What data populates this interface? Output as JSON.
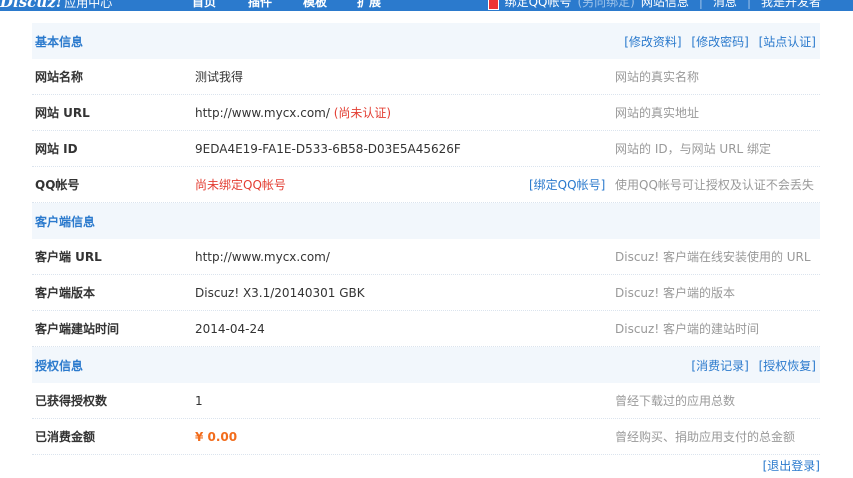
{
  "topbar": {
    "logo": "Discuz!",
    "logo_sub": "应用中心",
    "nav": [
      "首页",
      "插件",
      "模板",
      "扩展"
    ],
    "bind_qq": "绑定QQ帐号",
    "bind_qq_note": "(另向绑定)",
    "site_info": "网站信息",
    "message": "消息",
    "dev": "我是开发者"
  },
  "sections": {
    "basic": {
      "title": "基本信息",
      "actions": [
        "[修改资料]",
        "[修改密码]",
        "[站点认证]"
      ]
    },
    "client": {
      "title": "客户端信息"
    },
    "license": {
      "title": "授权信息",
      "actions": [
        "[消费记录]",
        "[授权恢复]"
      ]
    }
  },
  "rows": {
    "site_name": {
      "label": "网站名称",
      "value": "测试我得",
      "desc": "网站的真实名称"
    },
    "site_url": {
      "label": "网站 URL",
      "value": "http://www.mycx.com/",
      "status": "(尚未认证)",
      "desc": "网站的真实地址"
    },
    "site_id": {
      "label": "网站 ID",
      "value": "9EDA4E19-FA1E-D533-6B58-D03E5A45626F",
      "desc": "网站的 ID，与网站 URL 绑定"
    },
    "qq": {
      "label": "QQ帐号",
      "value": "尚未绑定QQ帐号",
      "action": "[绑定QQ帐号]",
      "desc": "使用QQ帐号可让授权及认证不会丢失"
    },
    "client_url": {
      "label": "客户端 URL",
      "value": "http://www.mycx.com/",
      "desc": "Discuz! 客户端在线安装使用的 URL"
    },
    "client_version": {
      "label": "客户端版本",
      "value": "Discuz! X3.1/20140301 GBK",
      "desc": "Discuz! 客户端的版本"
    },
    "client_date": {
      "label": "客户端建站时间",
      "value": "2014-04-24",
      "desc": "Discuz! 客户端的建站时间"
    },
    "licenses": {
      "label": "已获得授权数",
      "value": "1",
      "desc": "曾经下载过的应用总数"
    },
    "spent": {
      "label": "已消费金额",
      "value": "¥ 0.00",
      "desc": "曾经购买、捐助应用支付的总金额"
    }
  },
  "logout": "[退出登录]",
  "colors": {
    "accent": "#2b7acd",
    "warning": "#e33e33",
    "money": "#f26c1c",
    "section_bg": "#f2f7fc"
  }
}
